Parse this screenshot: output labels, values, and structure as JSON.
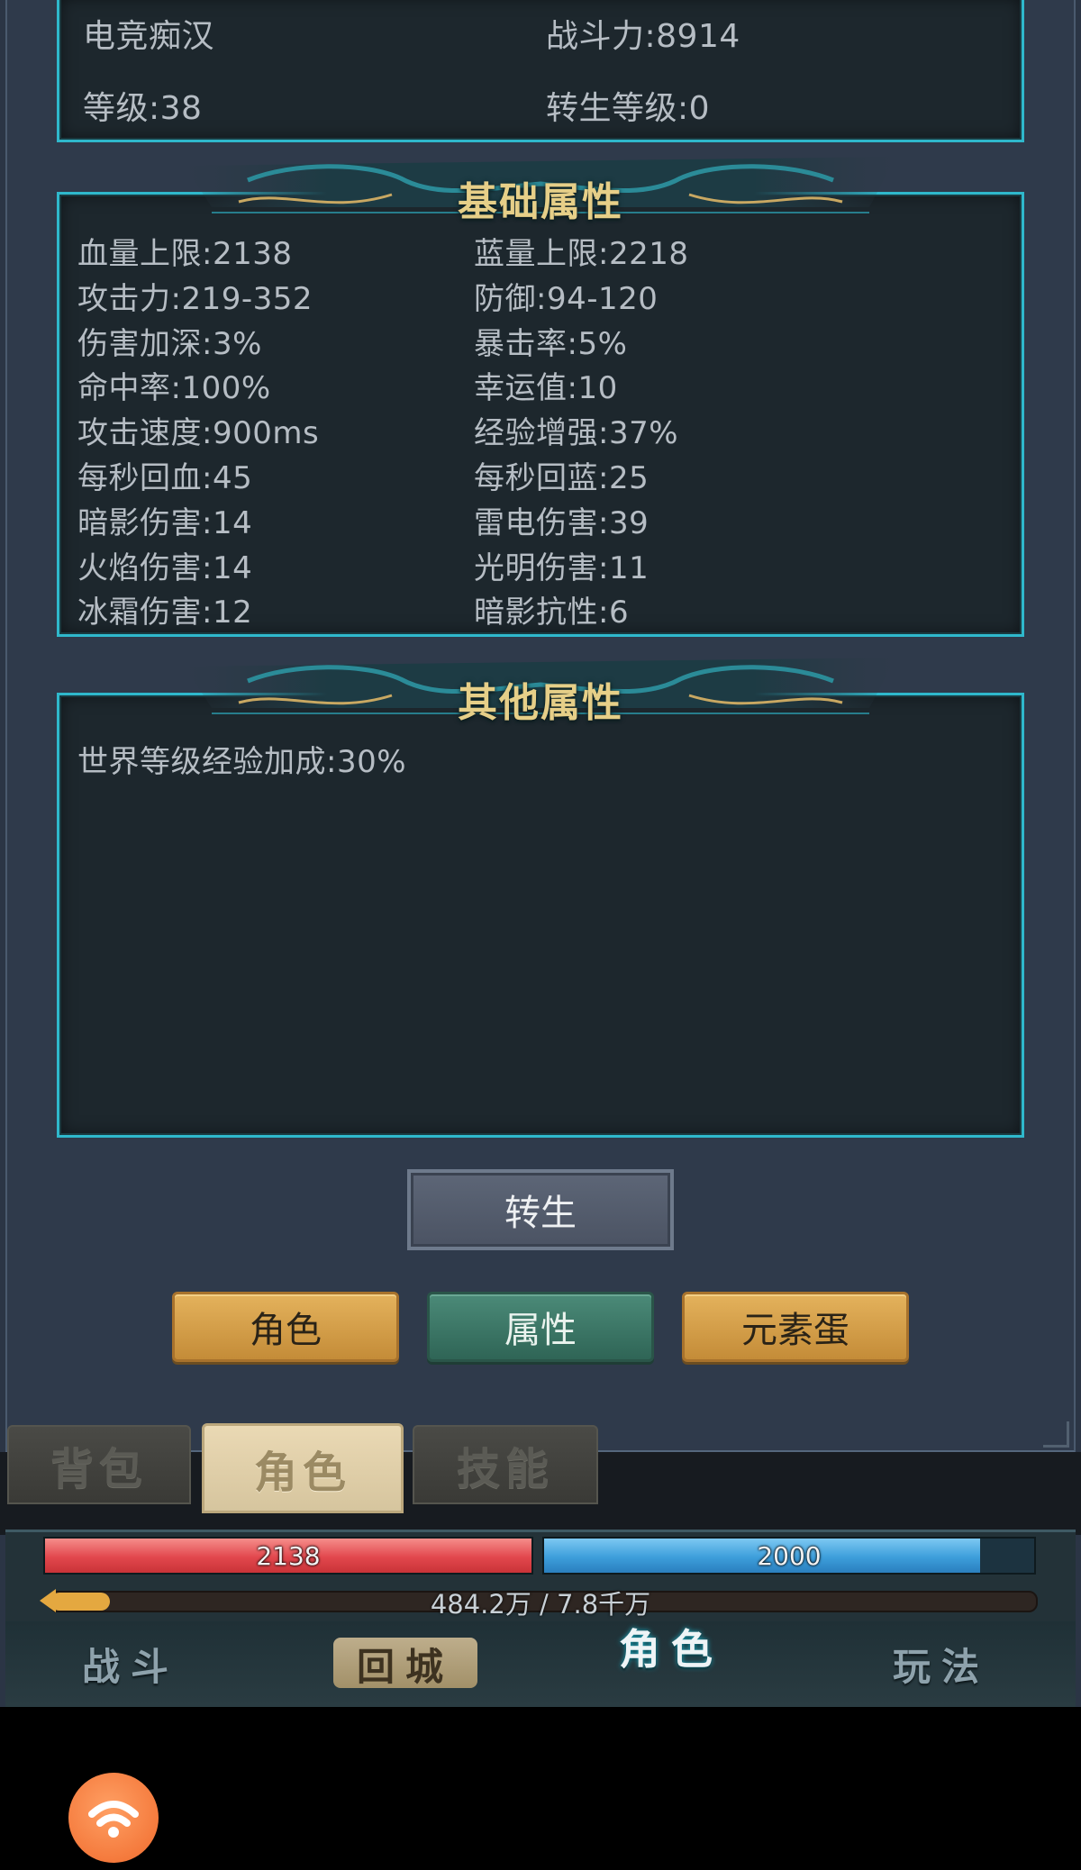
{
  "profile": {
    "name": "电竞痴汉",
    "power": "战斗力:8914",
    "level": "等级:38",
    "rebirth_level": "转生等级:0"
  },
  "basic_attributes": {
    "title": "基础属性",
    "rows": [
      {
        "left": "血量上限:2138",
        "right": "蓝量上限:2218"
      },
      {
        "left": "攻击力:219-352",
        "right": "防御:94-120"
      },
      {
        "left": "伤害加深:3%",
        "right": "暴击率:5%"
      },
      {
        "left": "命中率:100%",
        "right": "幸运值:10"
      },
      {
        "left": "攻击速度:900ms",
        "right": "经验增强:37%"
      },
      {
        "left": "每秒回血:45",
        "right": "每秒回蓝:25"
      },
      {
        "left": "暗影伤害:14",
        "right": "雷电伤害:39"
      },
      {
        "left": "火焰伤害:14",
        "right": "光明伤害:11"
      },
      {
        "left": "冰霜伤害:12",
        "right": "暗影抗性:6"
      }
    ]
  },
  "other_attributes": {
    "title": "其他属性",
    "items": [
      "世界等级经验加成:30%"
    ]
  },
  "buttons": {
    "rebirth": "转生",
    "role": "角色",
    "attributes": "属性",
    "element_egg": "元素蛋"
  },
  "bottom_tabs": {
    "bag": "背包",
    "role": "角色",
    "skills": "技能"
  },
  "hud": {
    "hp": "2138",
    "mp": "2000",
    "hp_fill": 1.0,
    "mp_fill": 0.89,
    "exp": "484.2万 / 7.8千万",
    "exp_fill": 0.06
  },
  "nav": {
    "battle": "战斗",
    "town": "回城",
    "role": "角色",
    "play": "玩法"
  },
  "colors": {
    "accent_border": "#2fb8cc",
    "title_gold": "#e6cf88",
    "hp_red": "#e85a5e",
    "mp_blue": "#3d9edb"
  }
}
